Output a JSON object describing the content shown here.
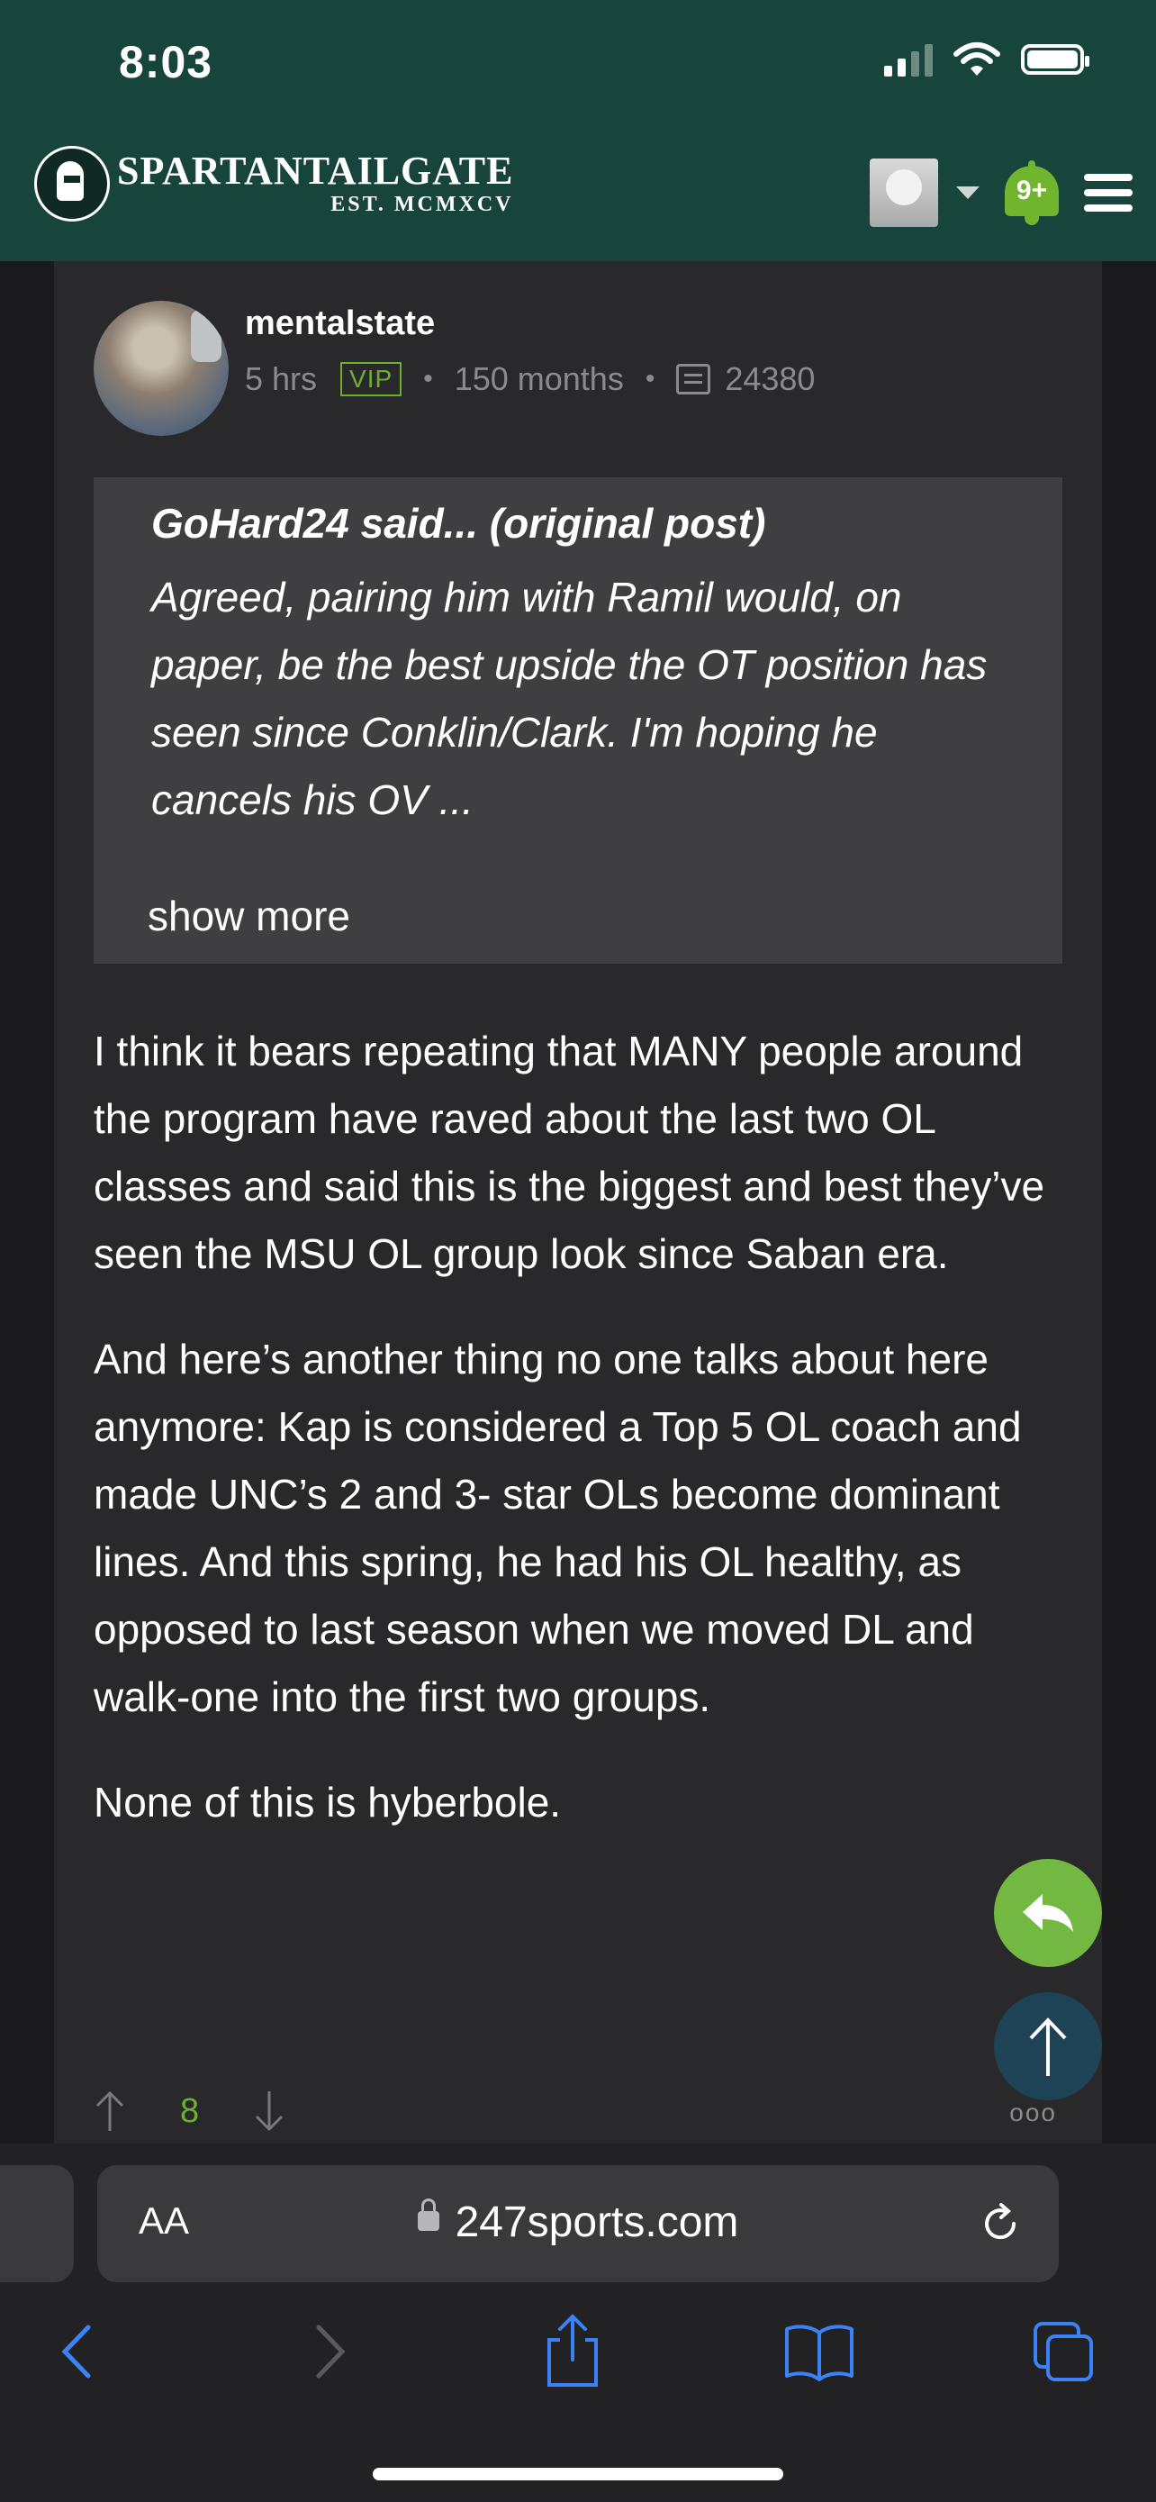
{
  "status_bar": {
    "time": "8:03"
  },
  "site": {
    "name": "SPARTANTAILGATE",
    "est": "EST. MCMXCV",
    "notification_count": "9+"
  },
  "post": {
    "author": "mentalstate",
    "time_ago": "5 hrs",
    "vip_badge": "VIP",
    "membership": "150 months",
    "post_count": "24380",
    "quote": {
      "author": "GoHard24 said...",
      "original_post_link": "(original post)",
      "text": "Agreed, pairing him with Ramil would, on paper, be the best upside the OT position has seen since Conklin/Clark. I'm hoping he cancels his OV ...",
      "show_more": "show more"
    },
    "paragraphs": [
      "I think it bears repeating that MANY people around the program have raved about the last two OL classes and said this is the biggest and best they’ve seen the MSU OL group look since Saban era.",
      "And here’s another thing no one talks about here anymore: Kap is considered a Top 5 OL coach and made UNC’s 2 and 3- star OLs become dominant lines. And this spring, he had his OL healthy, as opposed to last season when we moved DL and walk-one into the first two groups.",
      "None of this is hyberbole."
    ],
    "vote_count": "8",
    "more_dots": "ooo"
  },
  "browser": {
    "text_size_label": "AA",
    "url": "247sports.com"
  },
  "colors": {
    "header_green": "#18453b",
    "accent_green": "#6bb12c",
    "card_bg": "#29292b",
    "quote_bg": "#3f3f42",
    "ios_blue": "#3b82f6"
  }
}
